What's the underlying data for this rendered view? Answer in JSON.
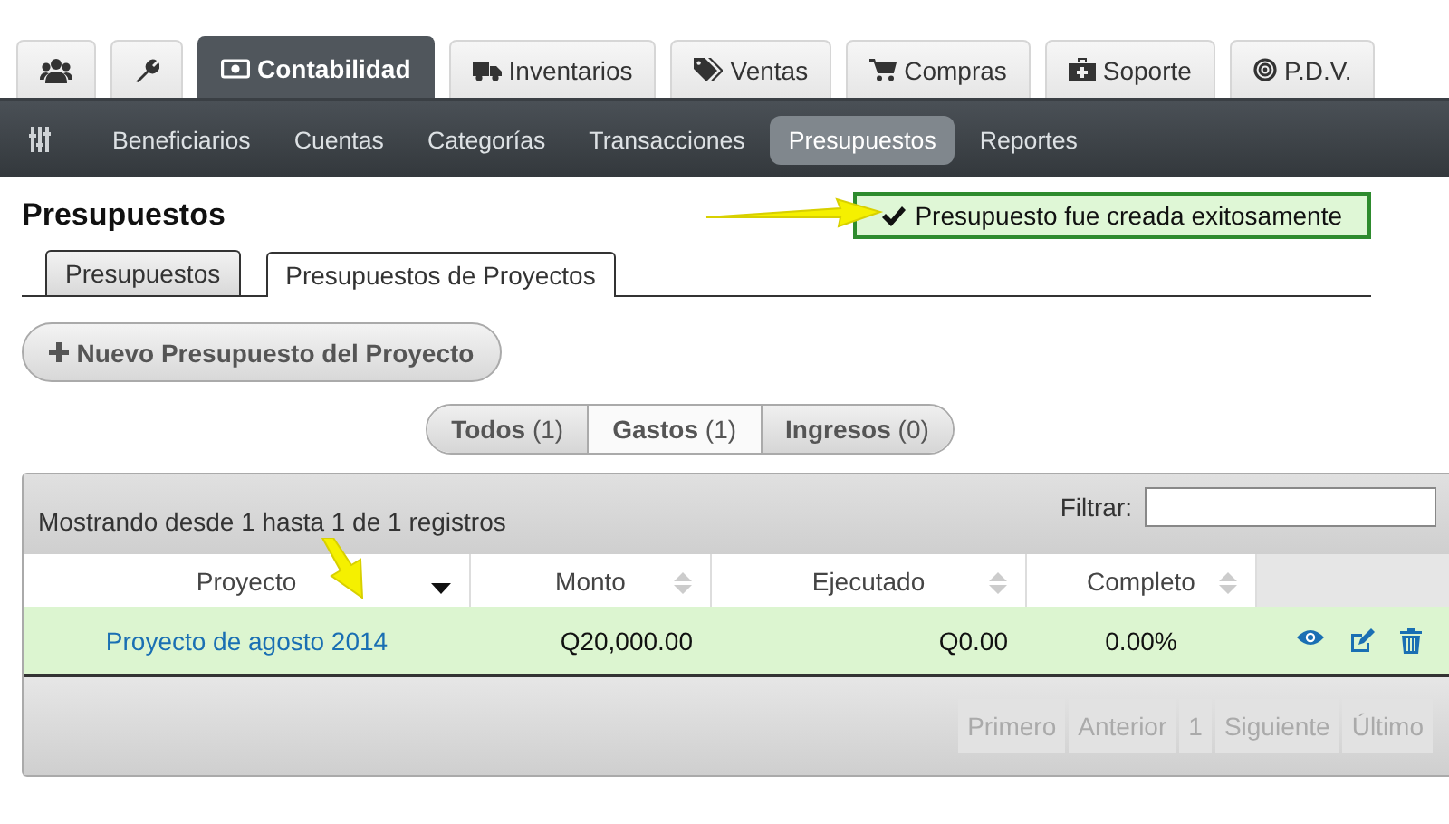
{
  "top_tabs": [
    {
      "selected": false
    },
    {
      "selected": false
    },
    {
      "label": "Contabilidad",
      "selected": true
    },
    {
      "label": "Inventarios",
      "selected": false
    },
    {
      "label": "Ventas",
      "selected": false
    },
    {
      "label": "Compras",
      "selected": false
    },
    {
      "label": "Soporte",
      "selected": false
    },
    {
      "label": "P.D.V.",
      "selected": false
    }
  ],
  "sub_nav": [
    {
      "label": "Beneficiarios",
      "selected": false
    },
    {
      "label": "Cuentas",
      "selected": false
    },
    {
      "label": "Categorías",
      "selected": false
    },
    {
      "label": "Transacciones",
      "selected": false
    },
    {
      "label": "Presupuestos",
      "selected": true
    },
    {
      "label": "Reportes",
      "selected": false
    }
  ],
  "page_title": "Presupuestos",
  "notice": "Presupuesto fue creada exitosamente",
  "page_tabs": [
    {
      "label": "Presupuestos",
      "selected": false
    },
    {
      "label": "Presupuestos de Proyectos",
      "selected": true
    }
  ],
  "new_button": "Nuevo Presupuesto del Proyecto",
  "filter_buttons": [
    {
      "label": "Todos",
      "count": "(1)",
      "selected": false
    },
    {
      "label": "Gastos",
      "count": "(1)",
      "selected": true
    },
    {
      "label": "Ingresos",
      "count": "(0)",
      "selected": false
    }
  ],
  "table": {
    "info": "Mostrando desde 1 hasta 1 de 1 registros",
    "filter_label": "Filtrar:",
    "columns": [
      {
        "label": "Proyecto",
        "sorted": true
      },
      {
        "label": "Monto",
        "sorted": false
      },
      {
        "label": "Ejecutado",
        "sorted": false
      },
      {
        "label": "Completo",
        "sorted": false
      }
    ],
    "rows": [
      {
        "cells": [
          "Proyecto de agosto 2014",
          "Q20,000.00",
          "Q0.00",
          "0.00%"
        ]
      }
    ],
    "pagination": [
      {
        "label": "Primero",
        "disabled": true
      },
      {
        "label": "Anterior",
        "disabled": true
      },
      {
        "label": "1",
        "disabled": true
      },
      {
        "label": "Siguiente",
        "disabled": true
      },
      {
        "label": "Último",
        "disabled": true
      }
    ]
  }
}
